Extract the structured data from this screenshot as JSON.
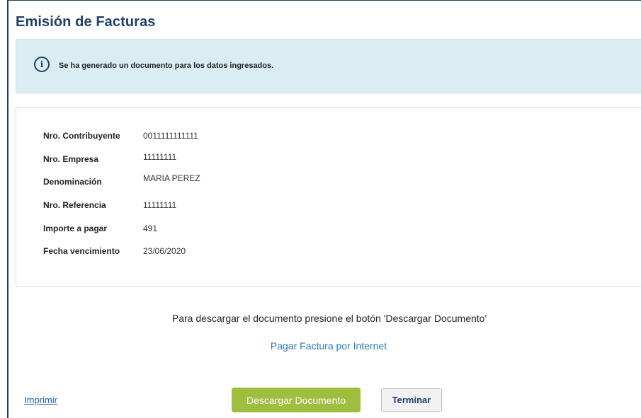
{
  "page": {
    "title": "Emisión de Facturas"
  },
  "alert": {
    "icon": "info-circle-icon",
    "icon_glyph": "i",
    "message": "Se ha generado un documento para los datos ingresados."
  },
  "details": {
    "rows": [
      {
        "label": "Nro. Contribuyente",
        "value": "0011111111111"
      },
      {
        "label": "Nro. Empresa",
        "value": "11111111"
      },
      {
        "label": "Denominación",
        "value": "MARIA PEREZ"
      },
      {
        "label": "Nro. Referencia",
        "value": "11111111"
      },
      {
        "label": "Importe a pagar",
        "value": "491"
      },
      {
        "label": "Fecha vencimiento",
        "value": "23/06/2020"
      }
    ]
  },
  "instructions": {
    "download_hint": "Para descargar el documento presione el botón 'Descargar Documento'",
    "pay_link": "Pagar Factura por Internet"
  },
  "actions": {
    "print_label": "Imprimir",
    "download_label": "Descargar Documento",
    "finish_label": "Terminar"
  },
  "colors": {
    "title": "#1f3f66",
    "alert_background": "#d9edf2",
    "download_button": "#9ebe3e",
    "link": "#2a7ab8"
  }
}
